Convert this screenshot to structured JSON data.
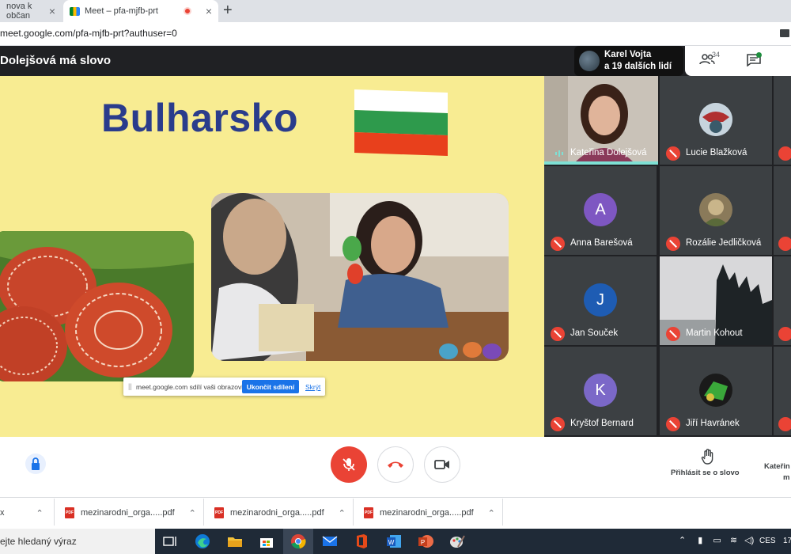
{
  "browser": {
    "tabs": [
      {
        "label": "nova k občan",
        "active": false
      },
      {
        "label": "Meet – pfa-mjfb-prt",
        "active": true,
        "recording": true
      }
    ],
    "url": "meet.google.com/pfa-mjfb-prt?authuser=0"
  },
  "meet": {
    "presenter_title": "Dolejšová má slovo",
    "pinned": {
      "name": "Karel Vojta",
      "more": "a 19 dalších lidí"
    },
    "people_count": "34"
  },
  "slide": {
    "title": "Bulharsko",
    "flag_colors": [
      "#ffffff",
      "#2e9a4c",
      "#e8401c"
    ]
  },
  "share_banner": {
    "text": "meet.google.com sdílí vaši obrazovku.",
    "stop_label": "Ukončit sdílení",
    "hide_label": "Skrýt"
  },
  "participants": [
    {
      "name": "Kateřina Dolejšová",
      "type": "video",
      "muted": false,
      "speaking": true
    },
    {
      "name": "Lucie Blažková",
      "type": "image",
      "muted": true
    },
    {
      "name": "Anna Barešová",
      "type": "initial",
      "initial": "A",
      "color": "#7e57c2",
      "muted": true
    },
    {
      "name": "Rozálie Jedličková",
      "type": "image",
      "muted": true
    },
    {
      "name": "Jan Souček",
      "type": "initial",
      "initial": "J",
      "color": "#1e5cb3",
      "muted": true
    },
    {
      "name": "Martin Kohout",
      "type": "video",
      "muted": true
    },
    {
      "name": "Kryštof Bernard",
      "type": "initial",
      "initial": "K",
      "color": "#7b68c8",
      "muted": true
    },
    {
      "name": "Jiří Havránek",
      "type": "image",
      "muted": true
    }
  ],
  "controls": {
    "raise_hand_label": "Přihlásit se o slovo",
    "presenting_label_1": "Kateřin",
    "presenting_label_2": "m"
  },
  "downloads": [
    {
      "name": "x"
    },
    {
      "name": "mezinarodni_orga.....pdf"
    },
    {
      "name": "mezinarodni_orga.....pdf"
    },
    {
      "name": "mezinarodni_orga.....pdf"
    }
  ],
  "taskbar": {
    "search_placeholder": "ejte hledaný výraz",
    "language": "CES",
    "clock": "17"
  }
}
